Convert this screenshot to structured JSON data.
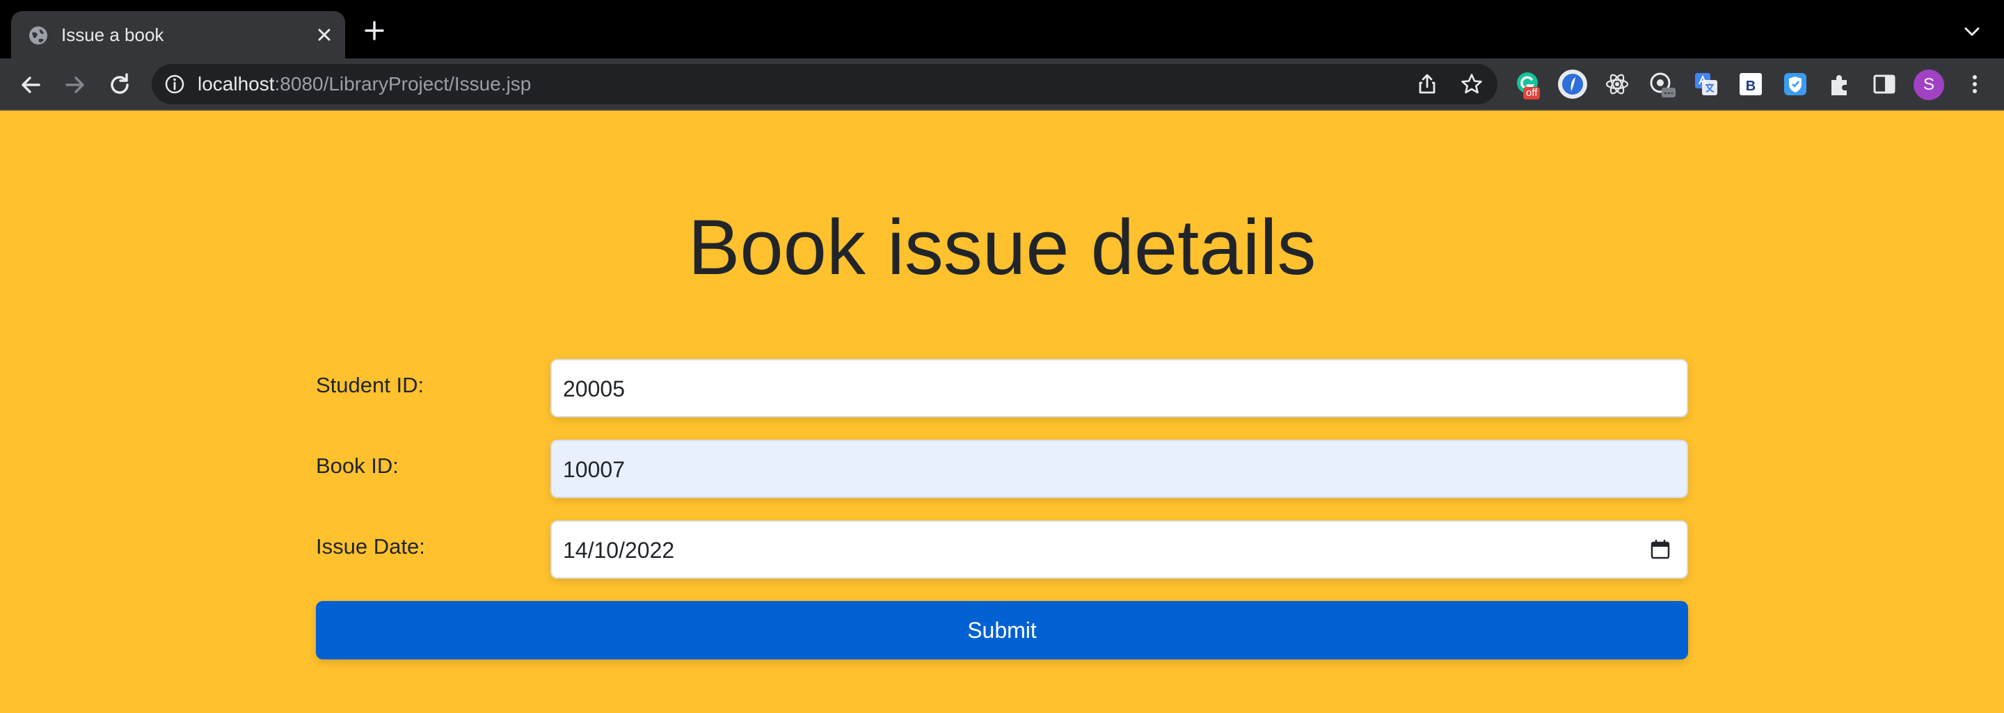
{
  "browser": {
    "tab_title": "Issue a book",
    "url_host": "localhost",
    "url_rest": ":8080/LibraryProject/Issue.jsp",
    "profile_initial": "S",
    "extension_badge": "off",
    "icons": [
      "globe-icon",
      "close-icon",
      "plus-icon",
      "chevron-down-icon",
      "back-arrow-icon",
      "forward-arrow-icon",
      "reload-icon",
      "info-icon",
      "share-icon",
      "star-icon",
      "puzzle-icon",
      "side-panel-icon",
      "more-vert-icon"
    ]
  },
  "page": {
    "title": "Book issue details",
    "background_color": "#ffc12d",
    "fields": {
      "student_id": {
        "label": "Student ID:",
        "value": "20005"
      },
      "book_id": {
        "label": "Book ID:",
        "value": "10007"
      },
      "issue_date": {
        "label": "Issue Date:",
        "value": "14/10/2022"
      }
    },
    "submit_label": "Submit",
    "submit_color": "#0261d2"
  }
}
